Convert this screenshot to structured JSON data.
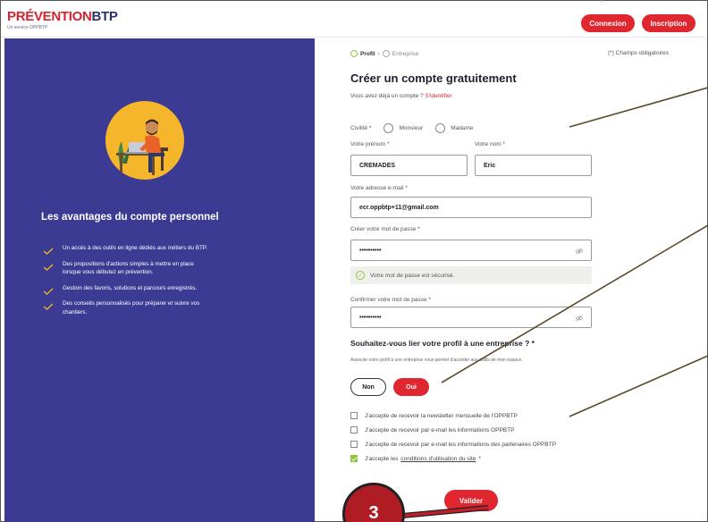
{
  "header": {
    "logo_prefix": "PRÉVENTION",
    "logo_suffix": "BTP",
    "logo_sub": "Un service OPPBTP",
    "connexion": "Connexion",
    "inscription": "Inscription"
  },
  "left": {
    "title": "Les avantages du compte personnel",
    "items": [
      "Un accès à des outils en ligne dédiés aux métiers du BTP.",
      "Des propositions d'actions simples à mettre en place lorsque vous débutez en prévention.",
      "Gestion des favoris, solutions et parcours enregistrés.",
      "Des conseils personnalisés pour préparer et suivre vos chantiers."
    ]
  },
  "steps": {
    "profil": "Profil",
    "separator": "›",
    "entreprise": "Entreprise",
    "required_note": "(*) Champs obligatoires"
  },
  "form": {
    "title": "Créer un compte gratuitement",
    "login_prefix": "Vous avez déjà un compte ?",
    "login_link": "S'identifier",
    "civilite_label": "Civilité *",
    "monsieur": "Monsieur",
    "madame": "Madame",
    "prenom_label": "Votre prénom *",
    "prenom_value": "CREMADES",
    "nom_label": "Votre nom *",
    "nom_value": "Eric",
    "email_label": "Votre adresse e-mail *",
    "email_value": "ecr.oppbtp+11@gmail.com",
    "password_label": "Créer votre mot de passe *",
    "password_value": "••••••••••",
    "secure_message": "Votre mot de passe est sécurisé.",
    "confirm_label": "Confirmer votre mot de passe *",
    "confirm_value": "••••••••••",
    "question": "Souhaitez-vous lier votre profil à une entreprise ? *",
    "question_sub": "Associer votre profil à une entreprise vous permet d'accéder aux outils de mon espace.",
    "non": "Non",
    "oui": "Oui",
    "checkbox_1": "J'accepte de recevoir la newsletter mensuelle de l'OPPBTP",
    "checkbox_2": "J'accepte de recevoir par e-mail les informations OPPBTP",
    "checkbox_3": "J'accepte de recevoir par e-mail les informations des partenaires OPPBTP",
    "checkbox_4_prefix": "J'accepte les",
    "checkbox_4_link": "conditions d'utilisation du site",
    "checkbox_4_suffix": "*",
    "valider": "Valider"
  },
  "annotation": {
    "badge": "3"
  },
  "colors": {
    "brand_red": "#e0262f",
    "panel_blue": "#3c3b94",
    "check_green": "#8cc63f",
    "logo_navy": "#2b2f6b"
  }
}
